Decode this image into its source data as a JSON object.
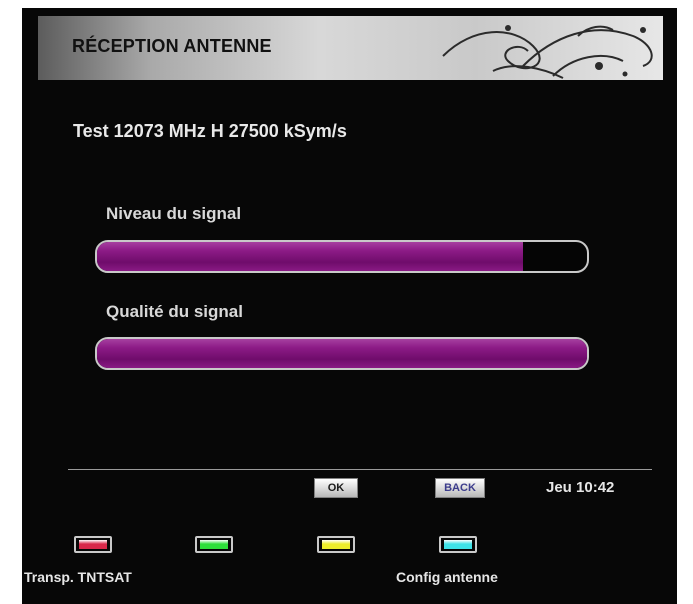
{
  "header": {
    "title": "RÉCEPTION ANTENNE"
  },
  "transponder": "Test 12073 MHz H 27500 kSym/s",
  "signal_level": {
    "label": "Niveau du signal",
    "percent": 87
  },
  "signal_quality": {
    "label": "Qualité du signal",
    "percent": 100
  },
  "keys": {
    "ok": "OK",
    "back": "BACK"
  },
  "clock": "Jeu 10:42",
  "color_buttons": [
    {
      "name": "red",
      "color": "#d8284a",
      "label": "Transp. TNTSAT"
    },
    {
      "name": "green",
      "color": "#2ee03a",
      "label": ""
    },
    {
      "name": "yellow",
      "color": "#ecec2a",
      "label": ""
    },
    {
      "name": "cyan",
      "color": "#3fe3e8",
      "label": "Config antenne"
    }
  ],
  "colors": {
    "bar_fill": "#8a1a85",
    "background": "#070707"
  }
}
